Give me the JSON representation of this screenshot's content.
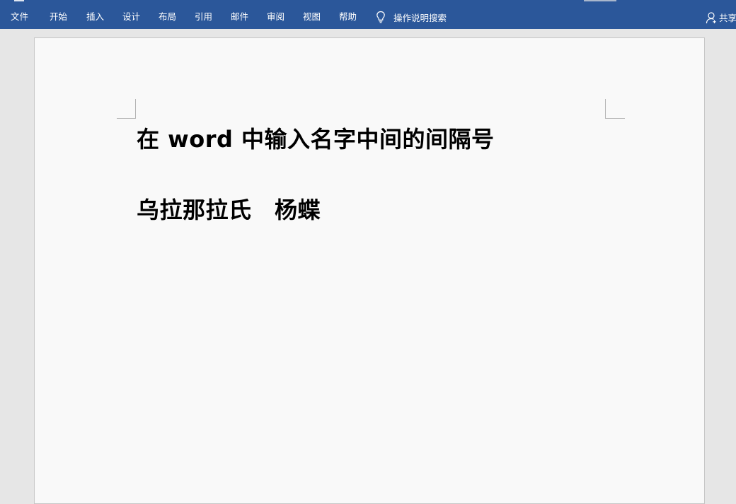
{
  "ribbon": {
    "tabs": [
      "文件",
      "开始",
      "插入",
      "设计",
      "布局",
      "引用",
      "邮件",
      "审阅",
      "视图",
      "帮助"
    ],
    "tell_me": "操作说明搜索",
    "share": "共享",
    "background_color": "#2b579a"
  },
  "document": {
    "lines": [
      "在 word 中输入名字中间的间隔号",
      "乌拉那拉氏　杨蝶"
    ]
  }
}
